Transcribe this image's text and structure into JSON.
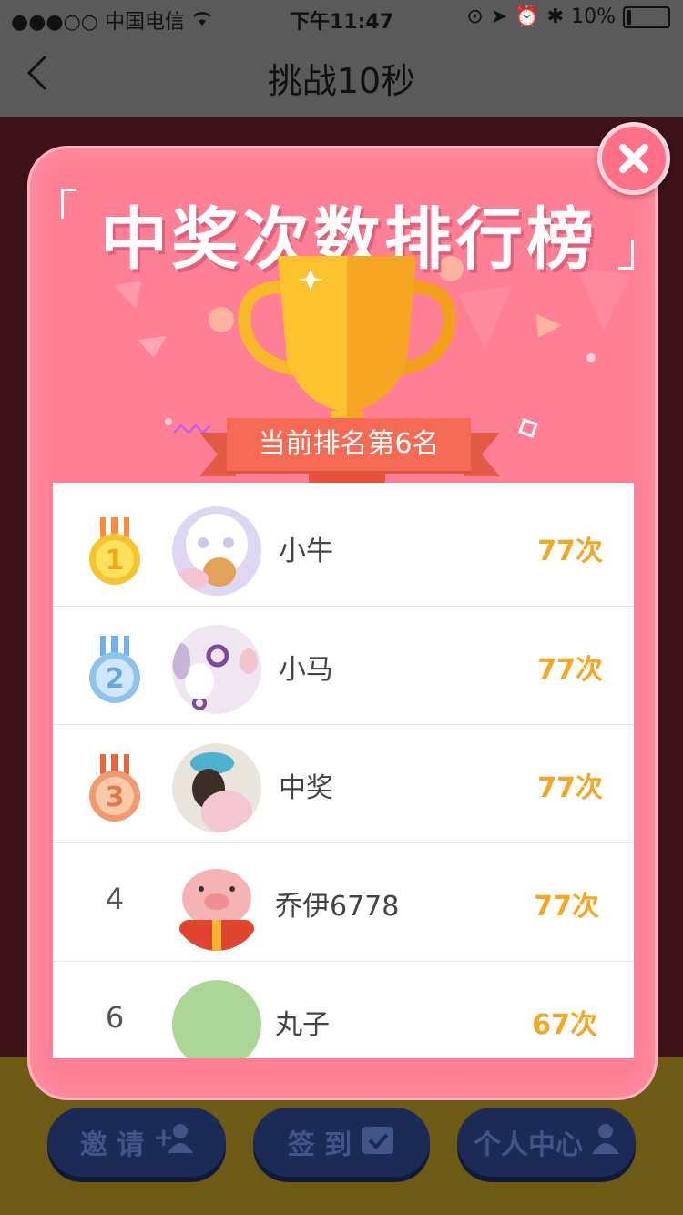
{
  "status_bar": {
    "carrier": "●●●○○ 中国电信",
    "time": "下午11:47",
    "battery": "10%"
  },
  "nav": {
    "title": "挑战10秒"
  },
  "background_buttons": {
    "invite": "邀 请",
    "checkin": "签 到",
    "profile": "个人中心"
  },
  "modal": {
    "title": "中奖次数排行榜",
    "current_rank": "当前排名第6名"
  },
  "leaderboard": [
    {
      "rank": "1",
      "name": "小牛",
      "score": "77次",
      "medal": "gold"
    },
    {
      "rank": "2",
      "name": "小马",
      "score": "77次",
      "medal": "silver"
    },
    {
      "rank": "3",
      "name": "中奖",
      "score": "77次",
      "medal": "bronze"
    },
    {
      "rank": "4",
      "name": "乔伊6778",
      "score": "77次",
      "medal": ""
    },
    {
      "rank": "6",
      "name": "丸子",
      "score": "67次",
      "medal": ""
    }
  ],
  "colors": {
    "modal_bg": "#ff8095",
    "score": "#f5a623",
    "ribbon": "#f46a55",
    "gold": "#f7c32e",
    "silver": "#8fc4ea",
    "bronze": "#f09a6d"
  },
  "icons": {
    "back": "chevron-left-icon",
    "close": "close-icon",
    "trophy": "trophy-icon",
    "invite": "add-user-icon",
    "checkin": "calendar-check-icon",
    "profile": "user-icon"
  }
}
